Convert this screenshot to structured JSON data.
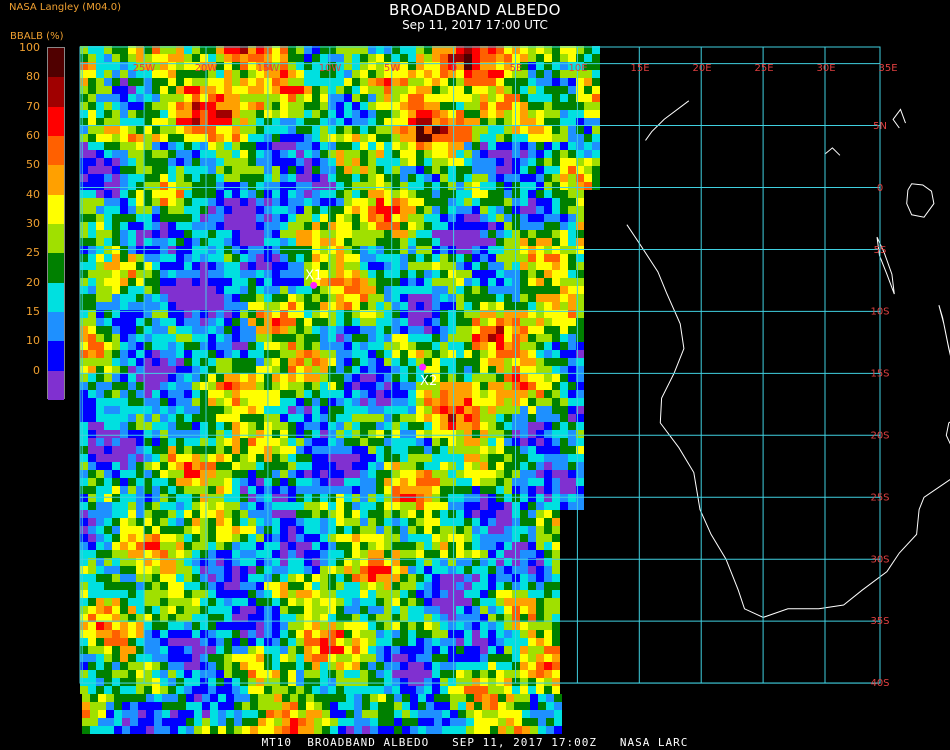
{
  "header": {
    "agency": "NASA Langley (M04.0)",
    "title": "BROADBAND ALBEDO",
    "datetime": "Sep 11, 2017 17:00 UTC",
    "param_label": "BBALB (%)"
  },
  "legend": {
    "ticks": [
      "100",
      "80",
      "70",
      "60",
      "50",
      "40",
      "30",
      "25",
      "20",
      "15",
      "10",
      "0"
    ],
    "colors": [
      "#500000",
      "#a00000",
      "#ff0000",
      "#ff6000",
      "#ffa000",
      "#ffff00",
      "#a0e000",
      "#008000",
      "#00e0e0",
      "#1e90ff",
      "#0000ff",
      "#8030d0"
    ]
  },
  "map": {
    "lon_labels": [
      "25W",
      "20W",
      "15W",
      "10W",
      "5W",
      "0",
      "5E",
      "10E",
      "15E",
      "20E",
      "25E",
      "30E",
      "35E"
    ],
    "lat_labels": [
      "5N",
      "0",
      "5S",
      "10S",
      "15S",
      "20S",
      "25S",
      "30S",
      "35S",
      "40S"
    ],
    "markers": [
      {
        "label": "X1",
        "lon": -16.3,
        "lat": -7.9
      },
      {
        "label": "X2",
        "lon": -7.5,
        "lat": -14.5
      }
    ],
    "colors": {
      "grid": "#40d0e0",
      "coast": "#ffffff",
      "grid_label": "#e04040",
      "marker": "#ff20ff"
    }
  },
  "footer": "MT10  BROADBAND ALBEDO   SEP 11, 2017 17:00Z   NASA LARC"
}
